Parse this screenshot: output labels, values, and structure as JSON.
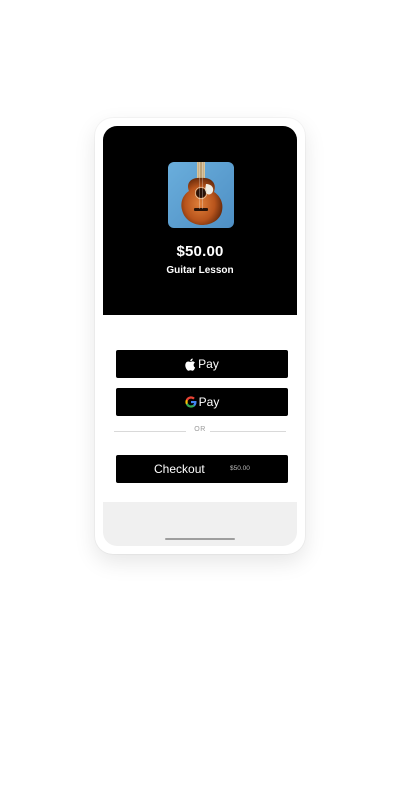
{
  "product": {
    "price": "$50.00",
    "name": "Guitar Lesson",
    "image_icon": "acoustic-guitar-image"
  },
  "payment": {
    "apple_pay_label": "Pay",
    "google_pay_label": "Pay",
    "divider_text": "OR",
    "checkout_label": "Checkout",
    "checkout_amount": "$50.00"
  },
  "colors": {
    "hero_background": "#000000",
    "button_background": "#000000",
    "image_background": "#5a9fd4",
    "guitar_body": "#b8541c"
  }
}
